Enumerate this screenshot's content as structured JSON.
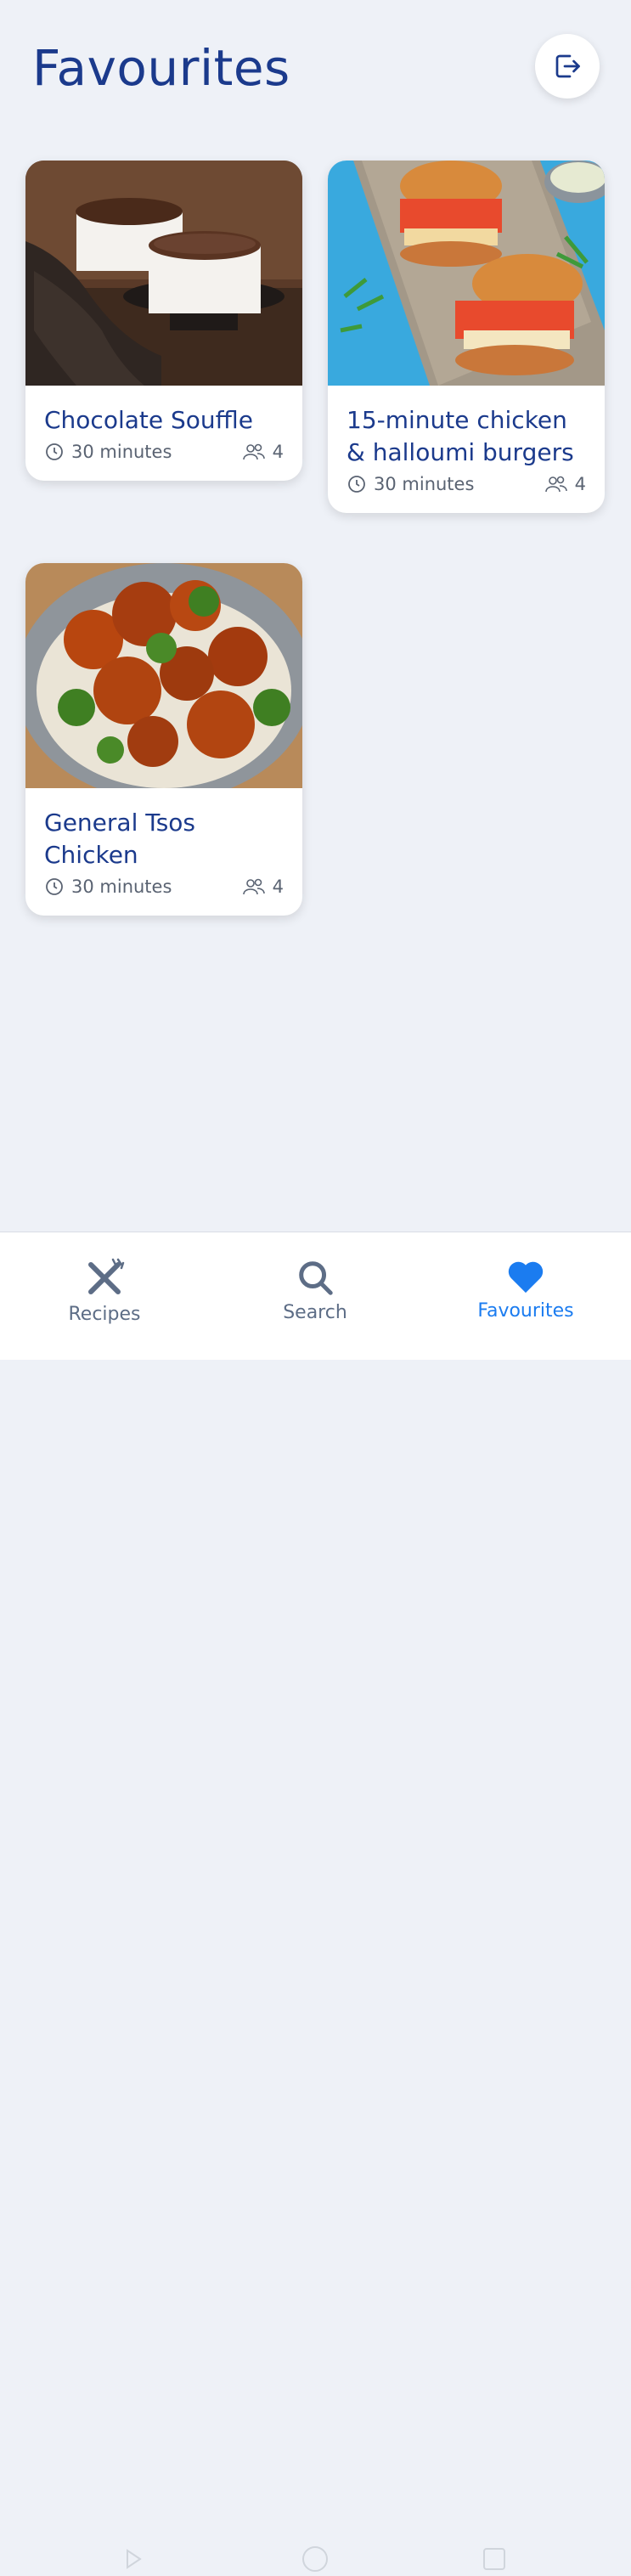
{
  "header": {
    "title": "Favourites",
    "logout_icon": "logout-icon"
  },
  "cards": [
    {
      "title": "Chocolate Souffle",
      "time": "30 minutes",
      "servings": "4",
      "image": "chocolate-souffle-photo"
    },
    {
      "title": "15-minute chicken & halloumi burgers",
      "time": "30 minutes",
      "servings": "4",
      "image": "chicken-halloumi-burgers-photo"
    },
    {
      "title": "General Tsos Chicken",
      "time": "30 minutes",
      "servings": "4",
      "image": "general-tsos-chicken-photo"
    }
  ],
  "nav": {
    "items": [
      {
        "label": "Recipes",
        "icon": "fork-knife-icon",
        "active": false
      },
      {
        "label": "Search",
        "icon": "search-icon",
        "active": false
      },
      {
        "label": "Favourites",
        "icon": "heart-icon",
        "active": true
      }
    ]
  },
  "colors": {
    "background": "#eef1f7",
    "title": "#1b3a8c",
    "active_nav": "#1b7cf0",
    "inactive_nav": "#5d6d86"
  }
}
